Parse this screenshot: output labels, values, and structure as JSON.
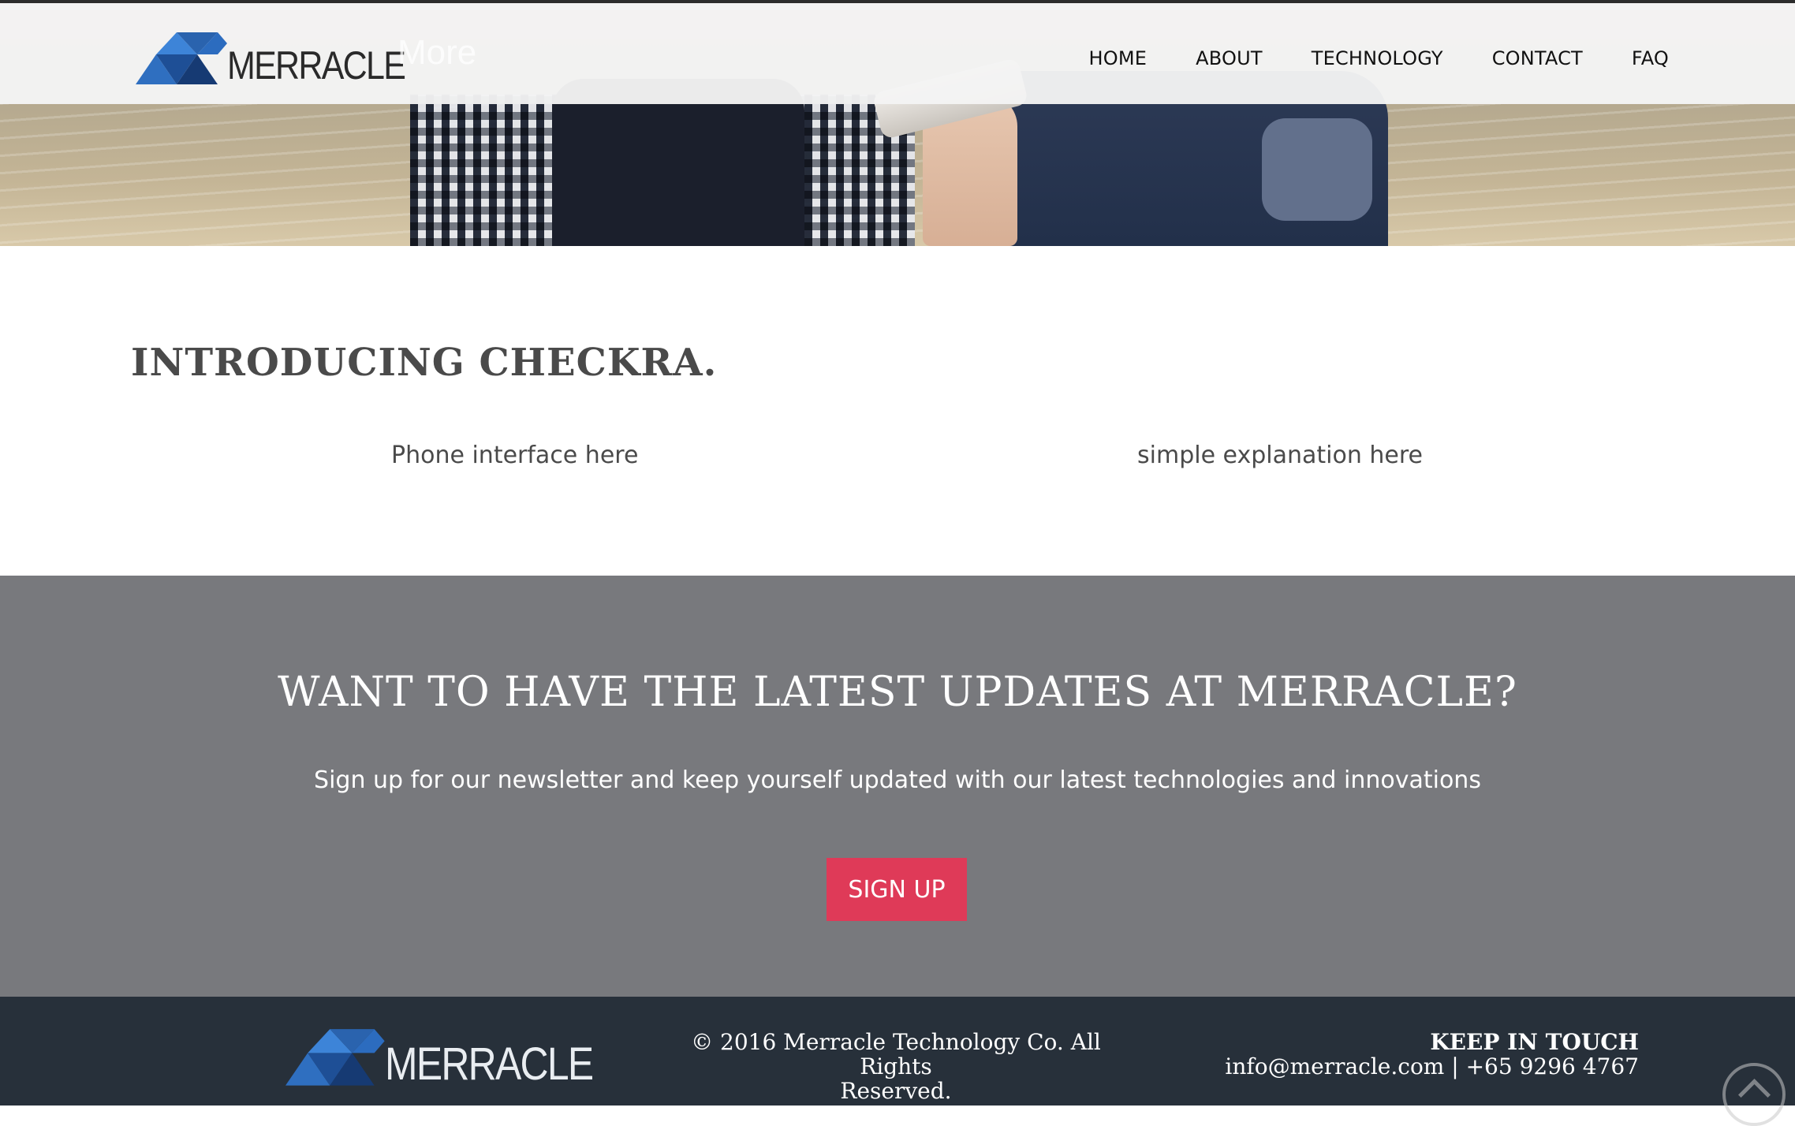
{
  "header": {
    "logo_text": "MERRACLE",
    "ghost_text": "More",
    "nav": [
      "HOME",
      "ABOUT",
      "TECHNOLOGY",
      "CONTACT",
      "FAQ"
    ]
  },
  "intro": {
    "title": "INTRODUCING CHECKRA.",
    "left_text": "Phone interface here",
    "right_text": "simple explanation here"
  },
  "newsletter": {
    "title": "WANT TO HAVE THE LATEST UPDATES AT MERRACLE?",
    "subtitle": "Sign up for our newsletter and keep yourself updated with our latest technologies and innovations",
    "button_label": "SIGN UP",
    "button_color": "#df3a58",
    "background_color": "#78797d"
  },
  "footer": {
    "logo_text": "MERRACLE",
    "copyright_line1": "© 2016 Merracle Technology Co. All Rights",
    "copyright_line2": "Reserved.",
    "keep_title": "KEEP IN TOUCH",
    "keep_info": "info@merracle.com | +65 9296 4767",
    "background_color": "#27303a"
  },
  "icons": {
    "logo": "triangles-logo-icon",
    "scroll_top": "chevron-up-circle-icon"
  }
}
